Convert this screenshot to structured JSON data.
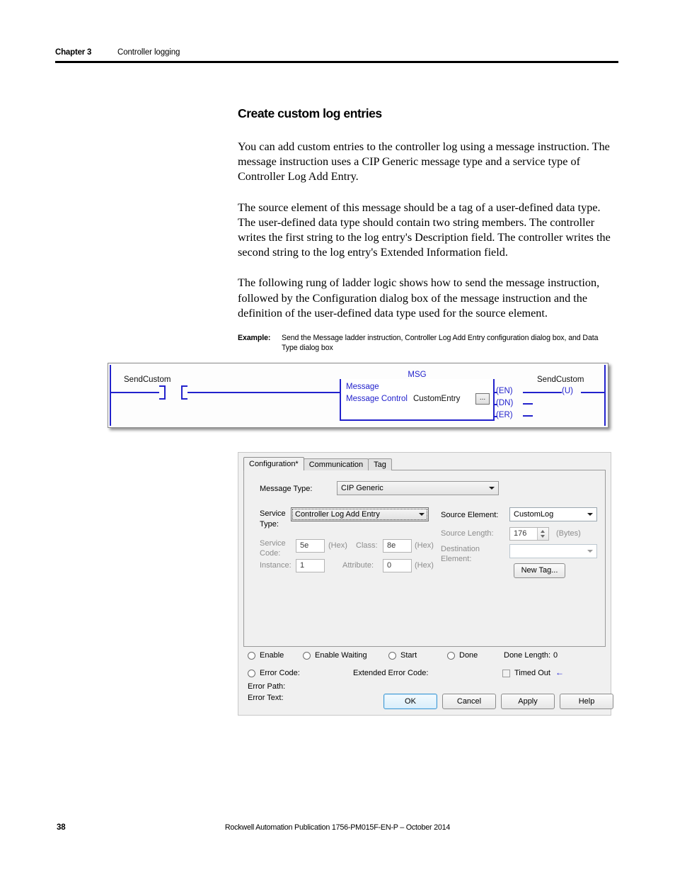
{
  "header": {
    "chapter": "Chapter 3",
    "topic": "Controller logging"
  },
  "section": {
    "title": "Create custom log entries",
    "paragraphs": [
      "You can add custom entries to the controller log using a message instruction. The message instruction uses a CIP Generic message type and a service type of Controller Log Add Entry.",
      "The source element of this message should be a tag of a user-defined data type. The user-defined data type should contain two string members. The controller writes the first string to the log entry's Description field. The controller writes the second string to the log entry's Extended Information field.",
      "The following rung of ladder logic shows how to send the message instruction, followed by the Configuration dialog box of the message instruction and the definition of the user-defined data type used for the source element."
    ]
  },
  "example": {
    "label": "Example:",
    "text": "Send the Message ladder instruction, Controller Log Add Entry configuration dialog box, and Data Type dialog box"
  },
  "ladder": {
    "input_tag": "SendCustom",
    "output_tag": "SendCustom",
    "msg_block_title": "MSG",
    "msg_line1": "Message",
    "msg_control_label": "Message Control",
    "msg_control_tag": "CustomEntry",
    "ellipsis_button": "...",
    "terminals": [
      "(EN)",
      "(DN)",
      "(ER)"
    ],
    "coil": "(U)",
    "wire_color": "#2222cc"
  },
  "dialog": {
    "tabs": [
      {
        "label": "Configuration*",
        "active": true
      },
      {
        "label": "Communication",
        "active": false
      },
      {
        "label": "Tag",
        "active": false
      }
    ],
    "message_type": {
      "label": "Message Type:",
      "value": "CIP Generic"
    },
    "service_type": {
      "label_line1": "Service",
      "label_line2": "Type:",
      "value": "Controller Log Add Entry"
    },
    "service_code": {
      "label_line1": "Service",
      "label_line2": "Code:",
      "value": "5e",
      "hex": "(Hex)"
    },
    "class": {
      "label": "Class:",
      "value": "8e",
      "hex": "(Hex)"
    },
    "instance": {
      "label": "Instance:",
      "value": "1"
    },
    "attribute": {
      "label": "Attribute:",
      "value": "0",
      "hex": "(Hex)"
    },
    "source_element": {
      "label": "Source Element:",
      "value": "CustomLog"
    },
    "source_length": {
      "label": "Source Length:",
      "value": "176",
      "units": "(Bytes)"
    },
    "destination_element": {
      "label_line1": "Destination",
      "label_line2": "Element:",
      "value": ""
    },
    "new_tag_button": "New Tag...",
    "status": {
      "enable": "Enable",
      "enable_waiting": "Enable Waiting",
      "start": "Start",
      "done": "Done",
      "done_length_label": "Done Length:",
      "done_length_value": "0",
      "error_code": "Error Code:",
      "extended_error_code": "Extended Error Code:",
      "timed_out": "Timed Out",
      "timed_out_arrow": "←",
      "error_path": "Error Path:",
      "error_text": "Error Text:"
    },
    "buttons": {
      "ok": "OK",
      "cancel": "Cancel",
      "apply": "Apply",
      "help": "Help"
    }
  },
  "footer": {
    "page_number": "38",
    "publication": "Rockwell Automation Publication 1756-PM015F-EN-P – October 2014"
  }
}
